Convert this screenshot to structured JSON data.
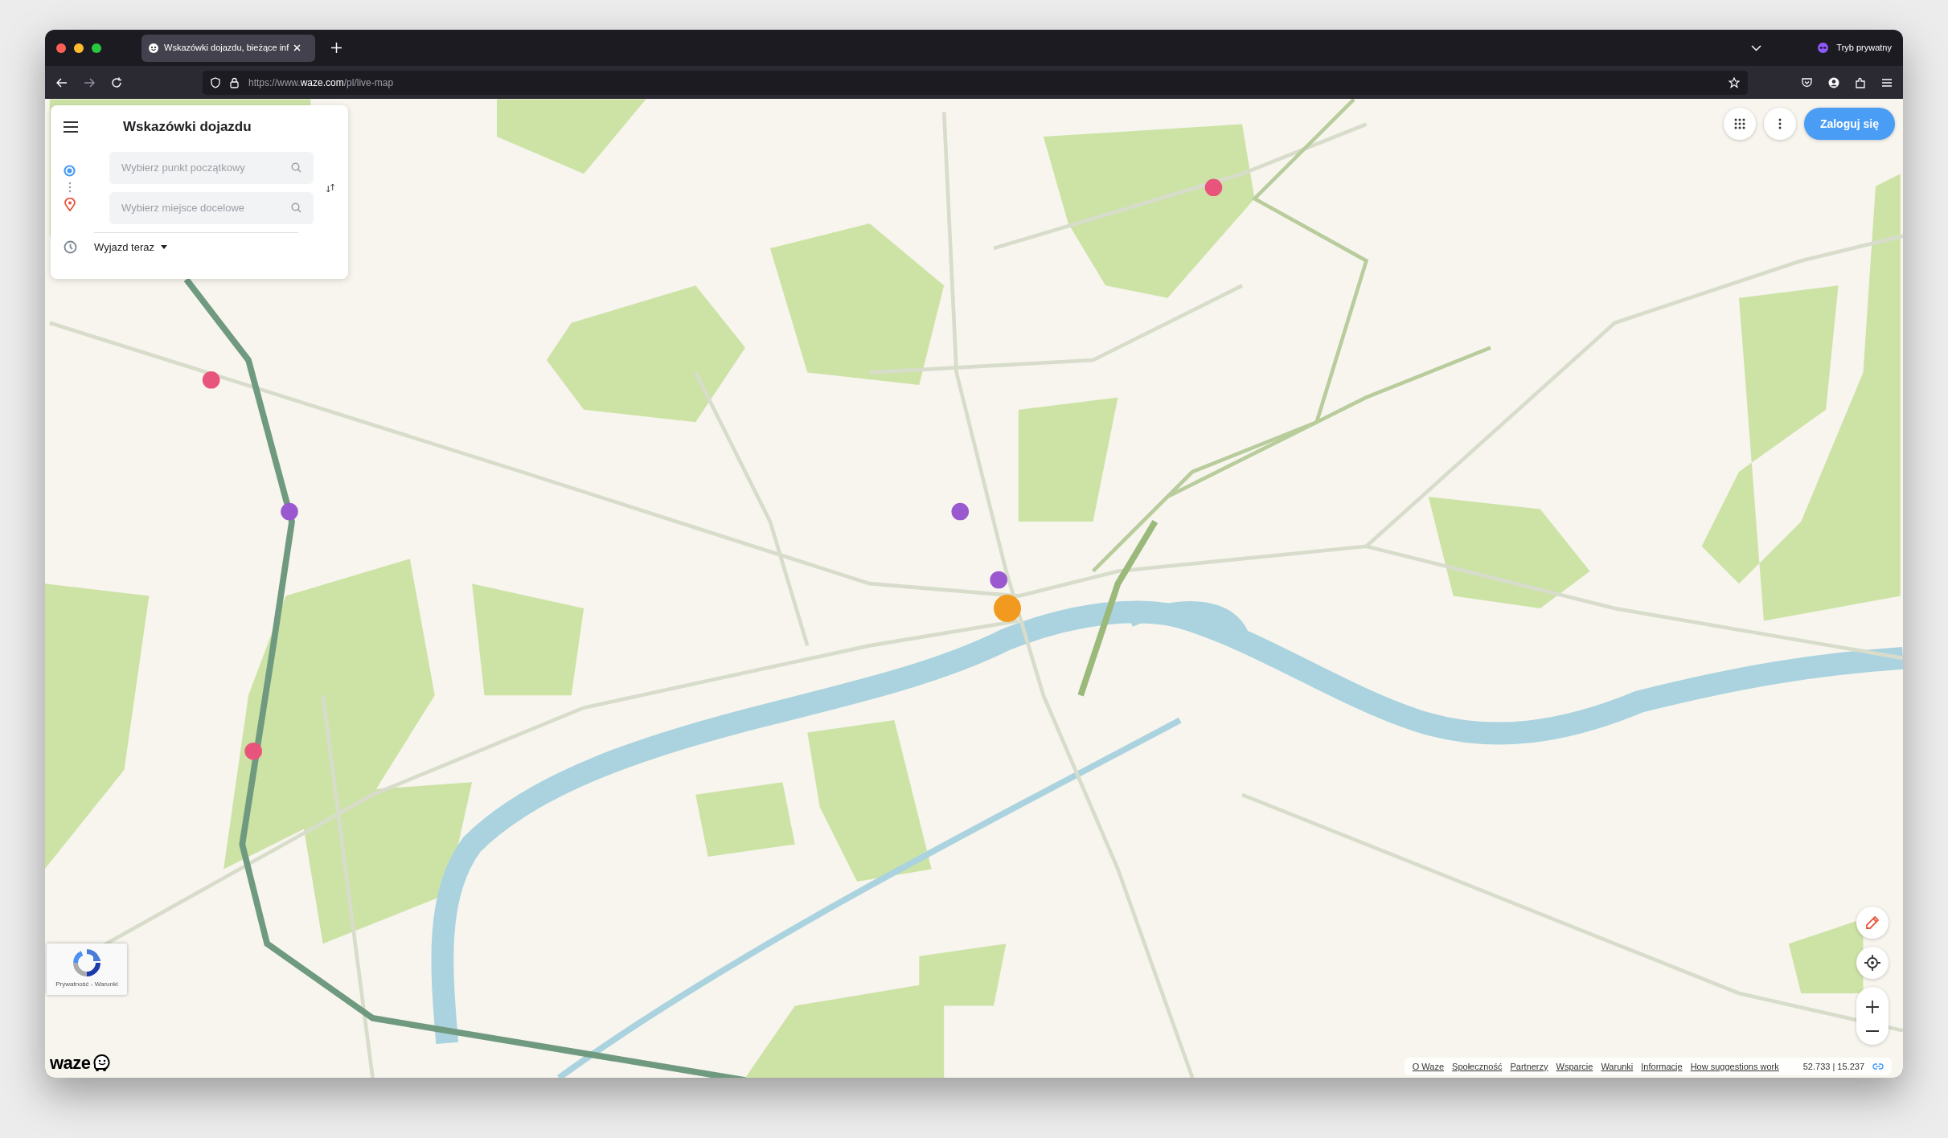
{
  "browser": {
    "tab_title": "Wskazówki dojazdu, bieżące inf",
    "url": "https://www.**waze.com**/pl/live-map",
    "private_mode_label": "Tryb prywatny"
  },
  "directions_panel": {
    "title": "Wskazówki dojazdu",
    "origin": {
      "placeholder": "Wybierz punkt początkowy"
    },
    "destination": {
      "placeholder": "Wybierz miejsce docelowe"
    },
    "departure": "Wyjazd teraz"
  },
  "top_actions": {
    "login": "Zaloguj się"
  },
  "recaptcha": {
    "text": "Prywatność - Warunki"
  },
  "logo": "waze",
  "footer": {
    "links": [
      "O Waze",
      "Społeczność",
      "Partnerzy",
      "Wsparcie",
      "Warunki",
      "Informacje",
      "How suggestions work"
    ],
    "coordinates": "52.733 | 15.237"
  }
}
